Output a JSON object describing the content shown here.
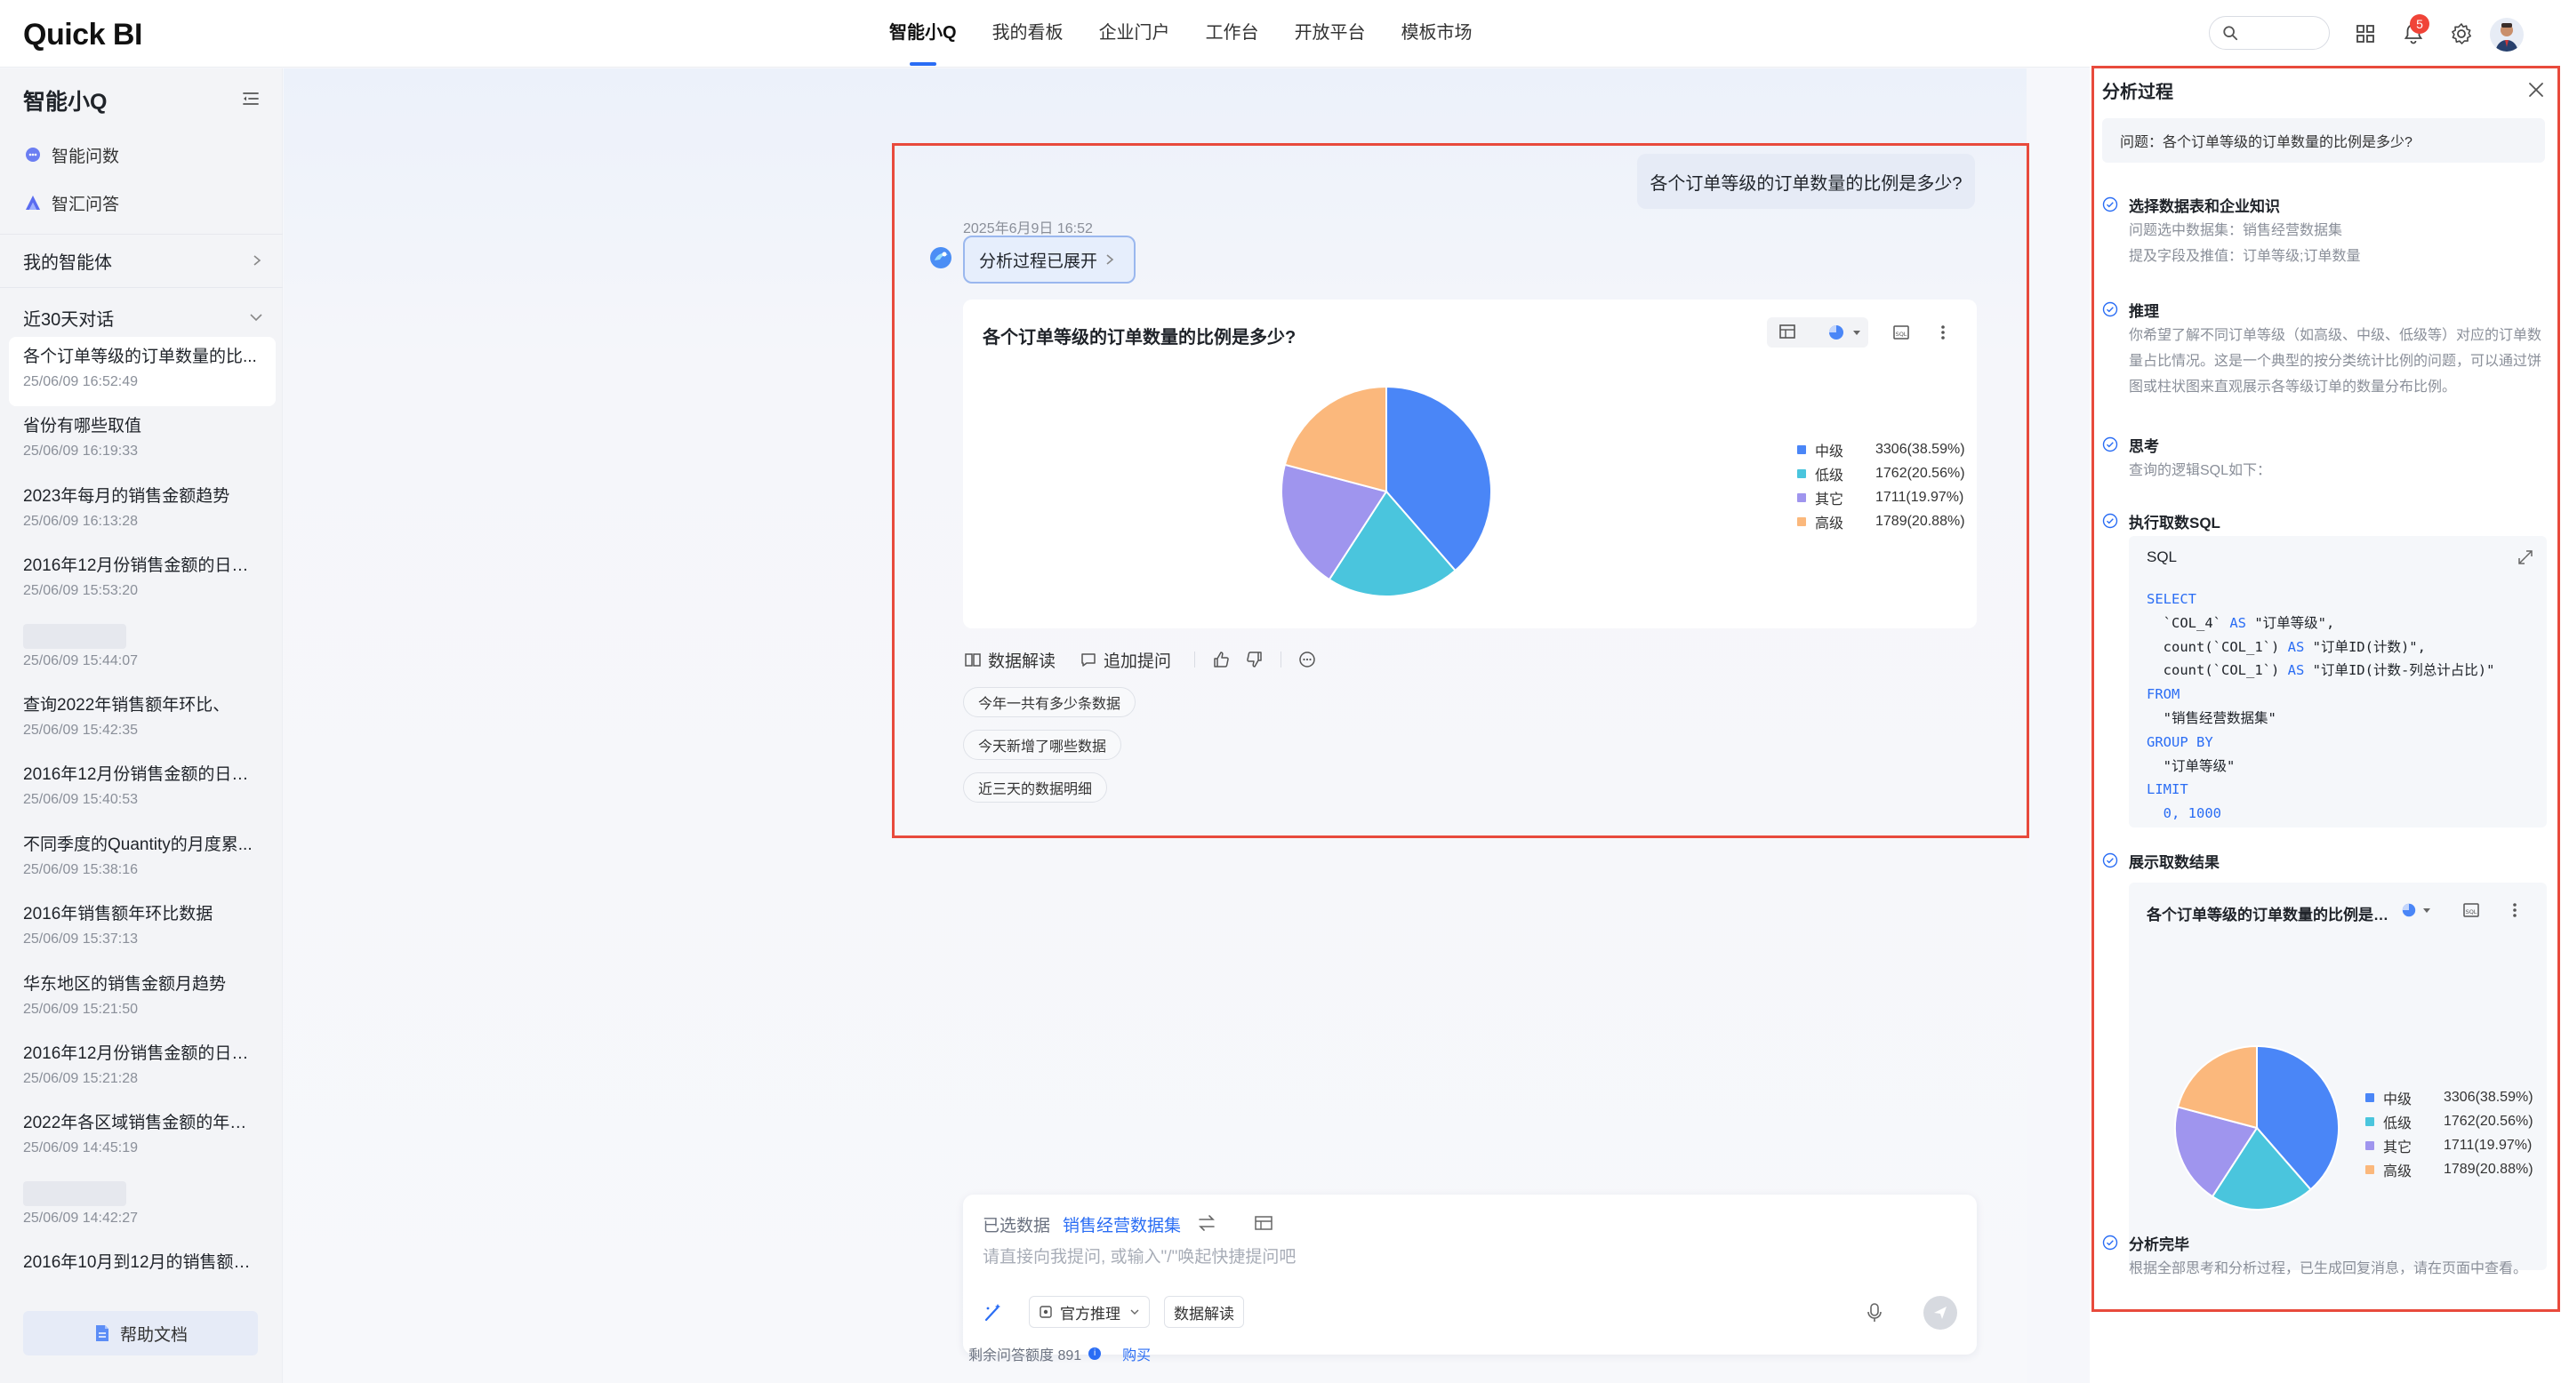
{
  "app": {
    "logo": "Quick BI"
  },
  "nav": {
    "items": [
      "智能小Q",
      "我的看板",
      "企业门户",
      "工作台",
      "开放平台",
      "模板市场"
    ],
    "active_index": 0
  },
  "header": {
    "notifications_count": "5"
  },
  "sidebar": {
    "title": "智能小Q",
    "nav": [
      {
        "label": "智能问数",
        "icon": "chat-data-icon"
      },
      {
        "label": "智汇问答",
        "icon": "qa-icon"
      }
    ],
    "agents_label": "我的智能体",
    "recent_label": "近30天对话",
    "conversations": [
      {
        "title": "各个订单等级的订单数量的比...",
        "date": "25/06/09 16:52:49",
        "active": true
      },
      {
        "title": "省份有哪些取值",
        "date": "25/06/09 16:19:33"
      },
      {
        "title": "2023年每月的销售金额趋势",
        "date": "25/06/09 16:13:28"
      },
      {
        "title": "2016年12月份销售金额的日环...",
        "date": "25/06/09 15:53:20"
      },
      {
        "title": "",
        "date": "25/06/09 15:44:07"
      },
      {
        "title": "查询2022年销售额年环比、",
        "date": "25/06/09 15:42:35"
      },
      {
        "title": "2016年12月份销售金额的日环...",
        "date": "25/06/09 15:40:53"
      },
      {
        "title": "不同季度的Quantity的月度累...",
        "date": "25/06/09 15:38:16"
      },
      {
        "title": "2016年销售额年环比数据",
        "date": "25/06/09 15:37:13"
      },
      {
        "title": "华东地区的销售金额月趋势",
        "date": "25/06/09 15:21:50"
      },
      {
        "title": "2016年12月份销售金额的日环...",
        "date": "25/06/09 15:21:28"
      },
      {
        "title": "2022年各区域销售金额的年环比",
        "date": "25/06/09 14:45:19"
      },
      {
        "title": "",
        "date": "25/06/09 14:42:27"
      },
      {
        "title": "2016年10月到12月的销售额和...",
        "date": ""
      }
    ],
    "help_label": "帮助文档"
  },
  "chat": {
    "user_question": "各个订单等级的订单数量的比例是多少?",
    "timestamp": "2025年6月9日 16:52",
    "analysis_chip": "分析过程已展开",
    "card_title": "各个订单等级的订单数量的比例是多少?",
    "actions": [
      "数据解读",
      "追加提问"
    ],
    "suggestions": [
      "今年一共有多少条数据",
      "今天新增了哪些数据",
      "近三天的数据明细"
    ]
  },
  "chart_data": {
    "type": "pie",
    "categories": [
      "中级",
      "低级",
      "其它",
      "高级"
    ],
    "values": [
      3306,
      1762,
      1711,
      1789
    ],
    "labels": [
      "3306(38.59%)",
      "1762(20.56%)",
      "1711(19.97%)",
      "1789(20.88%)"
    ],
    "percent": [
      38.59,
      20.56,
      19.97,
      20.88
    ],
    "colors": [
      "#4a86f7",
      "#4ac5dd",
      "#9f95ee",
      "#fbb87c"
    ],
    "legend_position": "right"
  },
  "input": {
    "selected_label": "已选数据",
    "dataset": "销售经营数据集",
    "placeholder": "请直接向我提问, 或输入\"/\"唤起快捷提问吧",
    "mode": "官方推理",
    "interpret": "数据解读",
    "quota_label": "剩余问答额度 891",
    "buy_label": "购买"
  },
  "panel": {
    "title": "分析过程",
    "question": "问题：各个订单等级的订单数量的比例是多少?",
    "steps": [
      {
        "title": "选择数据表和企业知识",
        "lines": [
          "问题选中数据集：销售经营数据集",
          "提及字段及推值：订单等级;订单数量"
        ]
      },
      {
        "title": "推理",
        "lines": [
          "你希望了解不同订单等级（如高级、中级、低级等）对应的订单数",
          "量占比情况。这是一个典型的按分类统计比例的问题，可以通过饼",
          "图或柱状图来直观展示各等级订单的数量分布比例。"
        ]
      },
      {
        "title": "思考",
        "lines": [
          "查询的逻辑SQL如下："
        ]
      },
      {
        "title": "执行取数SQL",
        "lines": []
      },
      {
        "title": "展示取数结果",
        "lines": []
      },
      {
        "title": "分析完毕",
        "lines": [
          "根据全部思考和分析过程，已生成回复消息，请在页面中查看。"
        ]
      }
    ],
    "sql_label": "SQL",
    "sql_lines": [
      "SELECT",
      "  `COL_4` AS \"订单等级\",",
      "  count(`COL_1`) AS \"订单ID(计数)\",",
      "  count(`COL_1`) AS \"订单ID(计数-列总计占比)\"",
      "FROM",
      "  \"销售经营数据集\"",
      "GROUP BY",
      "  \"订单等级\"",
      "LIMIT",
      "  0, 1000"
    ],
    "mini_title": "各个订单等级的订单数量的比例是多少?"
  }
}
